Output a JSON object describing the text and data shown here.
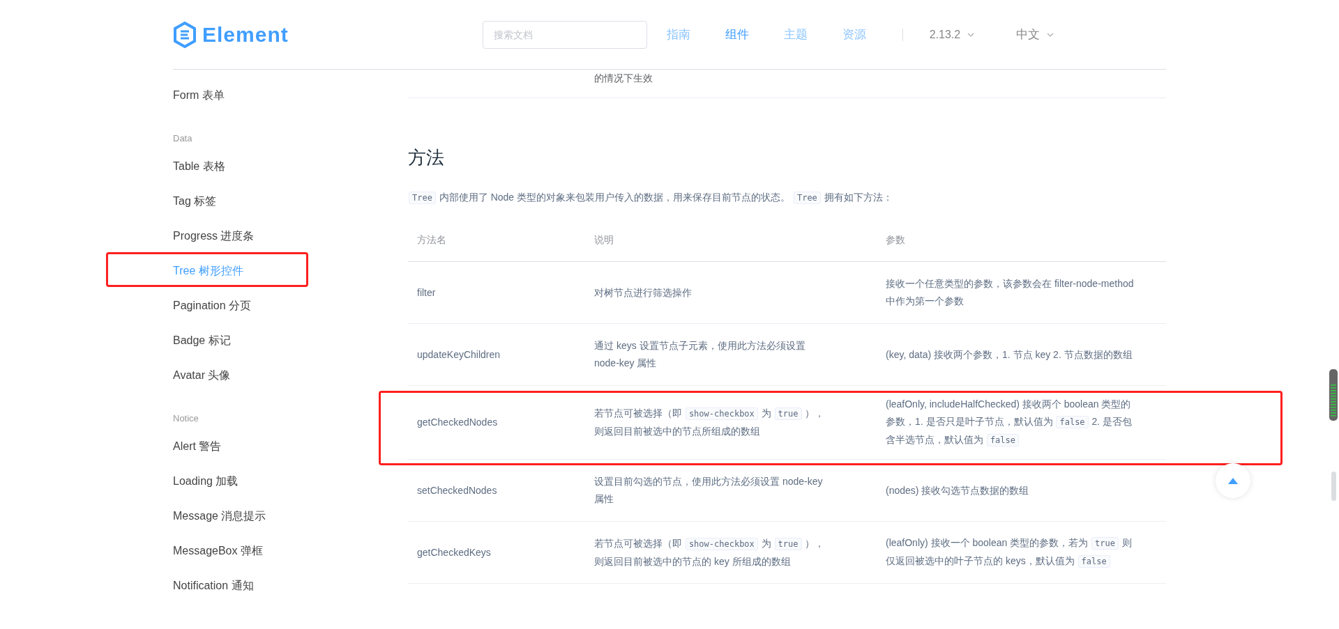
{
  "header": {
    "logo": "Element",
    "search": {
      "placeholder": "搜索文档"
    },
    "nav": [
      {
        "label": "指南",
        "selected": false
      },
      {
        "label": "组件",
        "selected": true
      },
      {
        "label": "主题",
        "selected": false
      },
      {
        "label": "资源",
        "selected": false
      }
    ],
    "version": "2.13.2",
    "language": "中文"
  },
  "sidebar": {
    "items": [
      {
        "kind": "item",
        "label": "Form 表单",
        "selected": false,
        "highlighted": false
      },
      {
        "kind": "group",
        "label": "Data"
      },
      {
        "kind": "item",
        "label": "Table 表格",
        "selected": false,
        "highlighted": false
      },
      {
        "kind": "item",
        "label": "Tag 标签",
        "selected": false,
        "highlighted": false
      },
      {
        "kind": "item",
        "label": "Progress 进度条",
        "selected": false,
        "highlighted": false
      },
      {
        "kind": "item",
        "label": "Tree 树形控件",
        "selected": true,
        "highlighted": true
      },
      {
        "kind": "item",
        "label": "Pagination 分页",
        "selected": false,
        "highlighted": false
      },
      {
        "kind": "item",
        "label": "Badge 标记",
        "selected": false,
        "highlighted": false
      },
      {
        "kind": "item",
        "label": "Avatar 头像",
        "selected": false,
        "highlighted": false
      },
      {
        "kind": "group",
        "label": "Notice"
      },
      {
        "kind": "item",
        "label": "Alert 警告",
        "selected": false,
        "highlighted": false
      },
      {
        "kind": "item",
        "label": "Loading 加载",
        "selected": false,
        "highlighted": false
      },
      {
        "kind": "item",
        "label": "Message 消息提示",
        "selected": false,
        "highlighted": false
      },
      {
        "kind": "item",
        "label": "MessageBox 弹框",
        "selected": false,
        "highlighted": false
      },
      {
        "kind": "item",
        "label": "Notification 通知",
        "selected": false,
        "highlighted": false
      }
    ]
  },
  "content": {
    "previous_row_fragment": "的情况下生效",
    "heading": "方法",
    "intro": [
      {
        "kind": "code",
        "text": "Tree"
      },
      {
        "kind": "text",
        "text": " 内部使用了 Node 类型的对象来包装用户传入的数据，用来保存目前节点的状态。 "
      },
      {
        "kind": "code",
        "text": "Tree"
      },
      {
        "kind": "text",
        "text": " 拥有如下方法："
      }
    ],
    "table": {
      "columns": [
        "方法名",
        "说明",
        "参数"
      ],
      "rows": [
        {
          "highlighted": false,
          "name": "filter",
          "description": [
            {
              "kind": "text",
              "text": "对树节点进行筛选操作"
            }
          ],
          "params": [
            {
              "kind": "text",
              "text": "接收一个任意类型的参数，该参数会在 filter-node-method 中作为第一个参数"
            }
          ]
        },
        {
          "highlighted": false,
          "name": "updateKeyChildren",
          "description": [
            {
              "kind": "text",
              "text": "通过 keys 设置节点子元素，使用此方法必须设置 node-key 属性"
            }
          ],
          "params": [
            {
              "kind": "text",
              "text": "(key, data) 接收两个参数，1. 节点 key 2. 节点数据的数组"
            }
          ]
        },
        {
          "highlighted": true,
          "name": "getCheckedNodes",
          "description": [
            {
              "kind": "text",
              "text": "若节点可被选择（即 "
            },
            {
              "kind": "code",
              "text": "show-checkbox"
            },
            {
              "kind": "text",
              "text": " 为 "
            },
            {
              "kind": "code",
              "text": "true"
            },
            {
              "kind": "text",
              "text": " ），则返回目前被选中的节点所组成的数组"
            }
          ],
          "params": [
            {
              "kind": "text",
              "text": "(leafOnly, includeHalfChecked) 接收两个 boolean 类型的参数，1. 是否只是叶子节点，默认值为 "
            },
            {
              "kind": "code",
              "text": "false"
            },
            {
              "kind": "text",
              "text": " 2. 是否包含半选节点，默认值为 "
            },
            {
              "kind": "code",
              "text": "false"
            }
          ]
        },
        {
          "highlighted": false,
          "name": "setCheckedNodes",
          "description": [
            {
              "kind": "text",
              "text": "设置目前勾选的节点，使用此方法必须设置 node-key 属性"
            }
          ],
          "params": [
            {
              "kind": "text",
              "text": "(nodes) 接收勾选节点数据的数组"
            }
          ]
        },
        {
          "highlighted": false,
          "name": "getCheckedKeys",
          "description": [
            {
              "kind": "text",
              "text": "若节点可被选择（即 "
            },
            {
              "kind": "code",
              "text": "show-checkbox"
            },
            {
              "kind": "text",
              "text": " 为 "
            },
            {
              "kind": "code",
              "text": "true"
            },
            {
              "kind": "text",
              "text": " ），则返回目前被选中的节点的 key 所组成的数组"
            }
          ],
          "params": [
            {
              "kind": "text",
              "text": "(leafOnly) 接收一个 boolean 类型的参数，若为 "
            },
            {
              "kind": "code",
              "text": "true"
            },
            {
              "kind": "text",
              "text": " 则仅返回被选中的叶子节点的 keys，默认值为 "
            },
            {
              "kind": "code",
              "text": "false"
            }
          ]
        }
      ]
    }
  }
}
